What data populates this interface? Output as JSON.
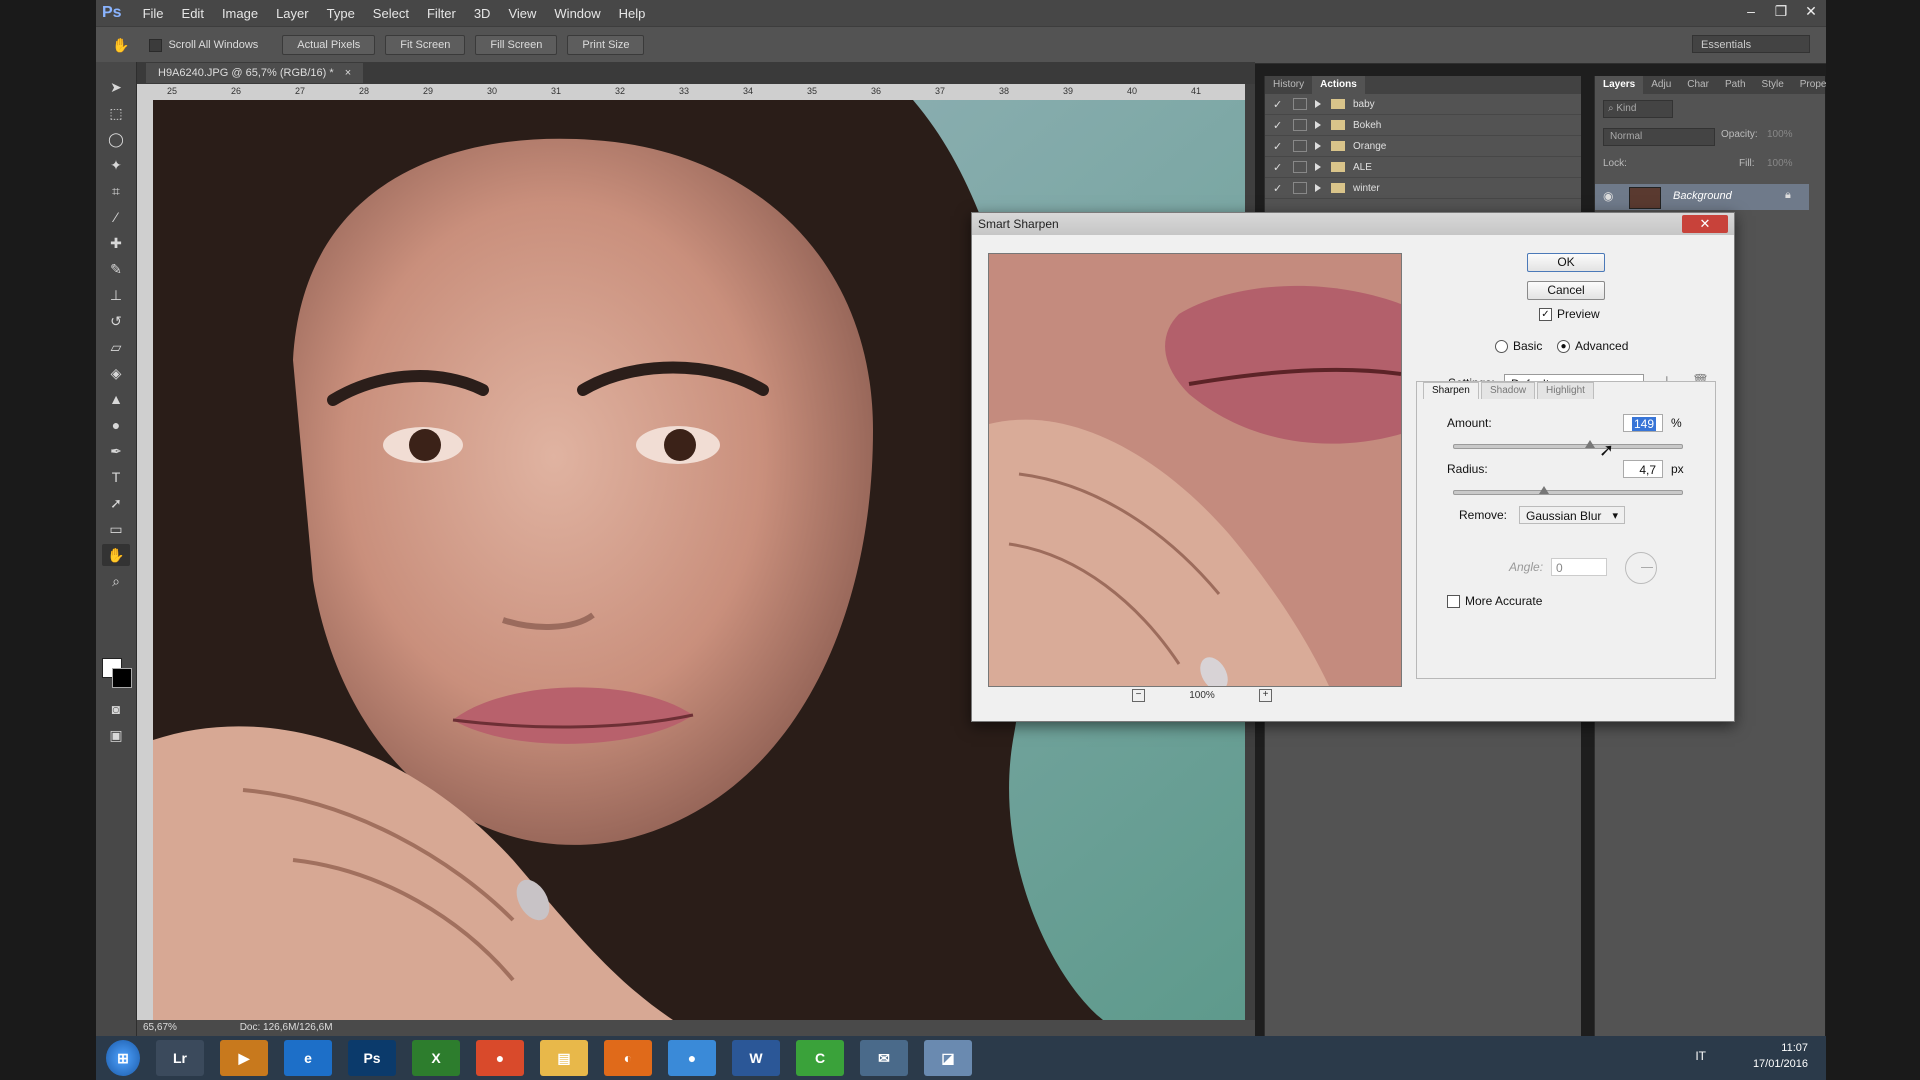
{
  "app": {
    "logo": "Ps",
    "menu": [
      "File",
      "Edit",
      "Image",
      "Layer",
      "Type",
      "Select",
      "Filter",
      "3D",
      "View",
      "Window",
      "Help"
    ],
    "window_controls": [
      "–",
      "❐",
      "✕"
    ]
  },
  "options_bar": {
    "scroll_all_windows": "Scroll All Windows",
    "buttons": [
      "Actual Pixels",
      "Fit Screen",
      "Fill Screen",
      "Print Size"
    ],
    "workspace": "Essentials"
  },
  "document": {
    "tab_title": "H9A6240.JPG @ 65,7% (RGB/16) *",
    "ruler_ticks": [
      "25",
      "26",
      "27",
      "28",
      "29",
      "30",
      "31",
      "32",
      "33",
      "34",
      "35",
      "36",
      "37",
      "38",
      "39",
      "40",
      "41"
    ],
    "zoom_status": "65,67%",
    "doc_info": "Doc: 126,6M/126,6M"
  },
  "actions_panel": {
    "tabs": [
      "History",
      "Actions"
    ],
    "active_tab": "Actions",
    "rows": [
      {
        "check": "✓",
        "name": "baby"
      },
      {
        "check": "✓",
        "name": "Bokeh"
      },
      {
        "check": "✓",
        "name": "Orange"
      },
      {
        "check": "✓",
        "name": "ALE"
      },
      {
        "check": "✓",
        "name": "winter"
      }
    ]
  },
  "layers_panel": {
    "tabs": [
      "Layers",
      "Adju",
      "Char",
      "Path",
      "Style",
      "Prope"
    ],
    "filter": "Kind",
    "blend_mode": "Normal",
    "opacity_label": "Opacity:",
    "opacity_value": "100%",
    "lock_label": "Lock:",
    "fill_label": "Fill:",
    "fill_value": "100%",
    "layer_name": "Background"
  },
  "dialog": {
    "title": "Smart Sharpen",
    "ok": "OK",
    "cancel": "Cancel",
    "preview_label": "Preview",
    "preview_checked": true,
    "basic": "Basic",
    "advanced": "Advanced",
    "mode_selected": "Advanced",
    "settings_label": "Settings:",
    "settings_value": "Default",
    "subtabs": [
      "Sharpen",
      "Shadow",
      "Highlight"
    ],
    "amount_label": "Amount:",
    "amount_value": "149",
    "amount_unit": "%",
    "amount_level_fraction": 0.6,
    "radius_label": "Radius:",
    "radius_value": "4,7",
    "radius_unit": "px",
    "radius_level_fraction": 0.4,
    "remove_label": "Remove:",
    "remove_value": "Gaussian Blur",
    "angle_label": "Angle:",
    "angle_value": "0",
    "more_accurate": "More Accurate",
    "more_accurate_checked": false,
    "zoom": "100%"
  },
  "taskbar": {
    "items": [
      "Lr",
      "▶",
      "e",
      "Ps",
      "X",
      "●",
      "▤",
      "◐",
      "●",
      "W",
      "C",
      "✉",
      "◪"
    ],
    "lang": "IT",
    "time": "11:07",
    "date": "17/01/2016"
  },
  "colors": {
    "ps_blue": "#8ab4ff",
    "dialog_close": "#c8423a",
    "folder": "#d9c48a"
  }
}
